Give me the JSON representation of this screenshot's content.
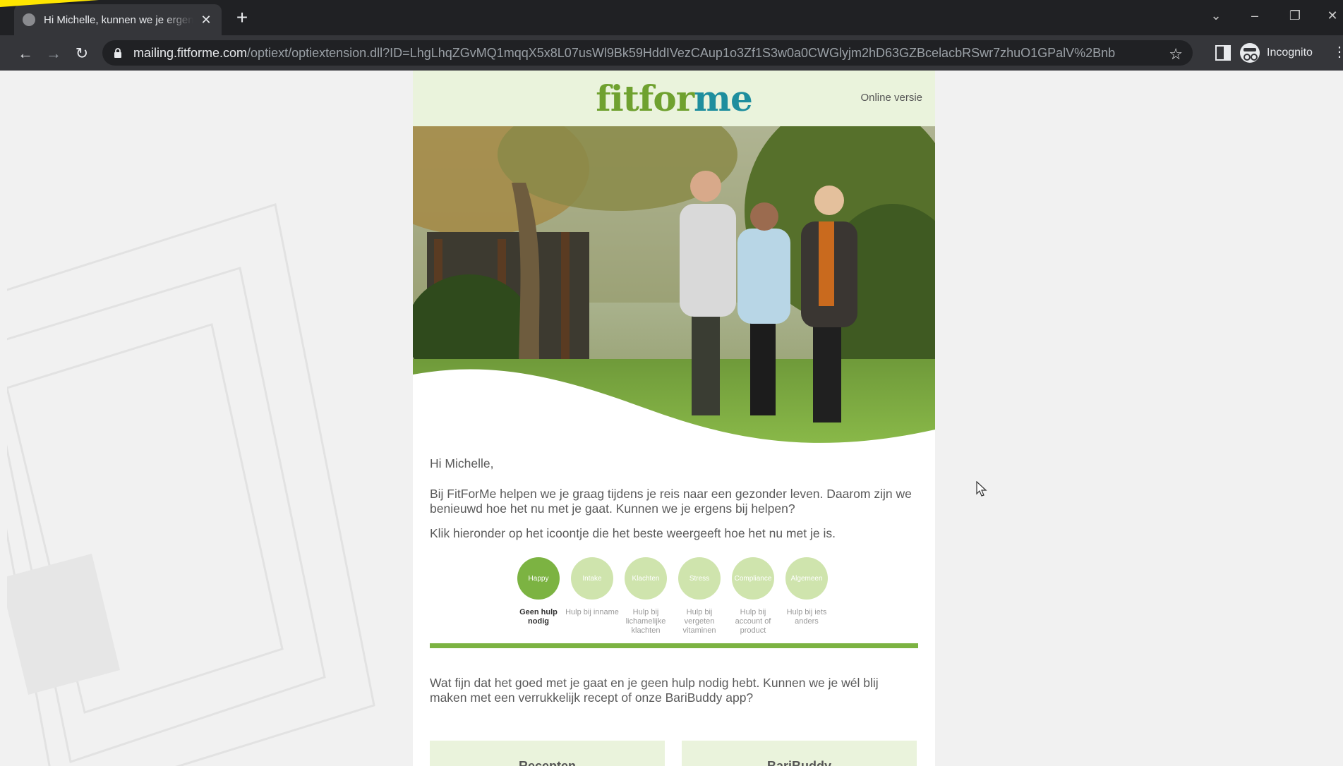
{
  "browser": {
    "tab_title": "Hi Michelle, kunnen we je ergens bij helpen?",
    "url_host": "mailing.fitforme.com",
    "url_path": "/optiext/optiextension.dll?ID=LhgLhqZGvMQ1mqqX5x8L07usWl9Bk59HddIVezCAup1o3Zf1S3w0a0CWGlyjm2hD63GZBcelacbRSwr7zhuO1GPalV%2Bnb",
    "incognito_label": "Incognito"
  },
  "email": {
    "logo_part1": "fitfor",
    "logo_part2": "me",
    "online_version": "Online versie",
    "greeting": "Hi Michelle,",
    "paragraph1": "Bij FitForMe helpen we je graag tijdens je reis naar een gezonder leven. Daarom zijn we benieuwd hoe het nu met je gaat. Kunnen we je ergens bij helpen?",
    "paragraph2": "Klik hieronder op het icoontje die het beste weergeeft hoe het nu met je is.",
    "icons": [
      {
        "label": "Happy",
        "caption": "Geen hulp nodig"
      },
      {
        "label": "Intake",
        "caption": "Hulp bij inname"
      },
      {
        "label": "Klachten",
        "caption": "Hulp bij lichamelijke klachten"
      },
      {
        "label": "Stress",
        "caption": "Hulp bij vergeten vitaminen"
      },
      {
        "label": "Compliance",
        "caption": "Hulp bij account of product"
      },
      {
        "label": "Algemeen",
        "caption": "Hulp bij iets anders"
      }
    ],
    "paragraph3": "Wat fijn dat het goed met je gaat en je geen hulp nodig hebt. Kunnen we je wél blij maken met een verrukkelijk recept of onze BariBuddy app?",
    "cards": [
      "Recepten",
      "BariBuddy"
    ]
  },
  "colors": {
    "brand_green": "#7cb342",
    "brand_teal": "#1e8e9e",
    "header_bg": "#eaf3dc",
    "chrome_dark": "#202124"
  }
}
